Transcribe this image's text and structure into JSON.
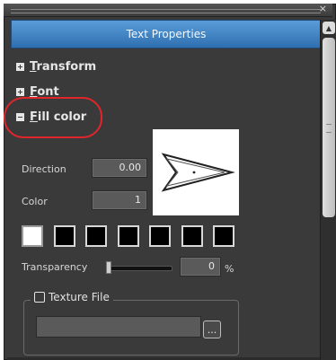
{
  "window": {
    "close_glyph": "×"
  },
  "header": {
    "title": "Text Properties"
  },
  "sections": {
    "transform": {
      "first": "T",
      "rest": "ransform"
    },
    "font": {
      "first": "F",
      "rest": "ont"
    },
    "fill_color": {
      "first": "F",
      "rest": "ill color"
    }
  },
  "fill": {
    "direction_label": "Direction",
    "direction_value": "0.00",
    "color_label": "Color",
    "color_value": "1",
    "swatch_colors": [
      "#ffffff",
      "#000000",
      "#000000",
      "#000000",
      "#000000",
      "#000000",
      "#000000"
    ],
    "transparency_label": "Transparency",
    "transparency_value": "0",
    "percent_sign": "%"
  },
  "texture": {
    "label": "Texture File",
    "path_value": "",
    "browse_label": "..."
  },
  "colors": {
    "header_blue": "#3f83c8",
    "highlight_red": "#e0262b",
    "panel_bg": "#3a3a3a"
  }
}
